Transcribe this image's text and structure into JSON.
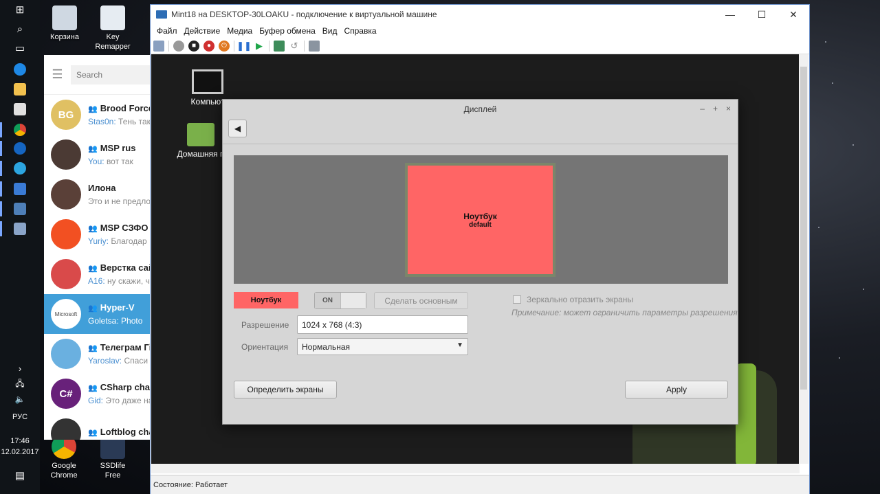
{
  "desktop": {
    "icons": [
      {
        "label": "Корзина"
      },
      {
        "label": "Key Remapper"
      },
      {
        "label": "Google Chrome"
      },
      {
        "label": "SSDlife Free"
      }
    ]
  },
  "taskbar": {
    "language": "РУС",
    "time": "17:46",
    "date": "12.02.2017"
  },
  "telegram": {
    "search_placeholder": "Search",
    "chats": [
      {
        "title": "Brood Force",
        "sender": "Stas0n:",
        "message": "Тень так",
        "initials": "BG",
        "color": "#e0c063",
        "group": true,
        "active": false
      },
      {
        "title": "MSP rus",
        "sender": "You:",
        "message": "вот так",
        "initials": "",
        "color": "#4b3a34",
        "group": true,
        "active": false
      },
      {
        "title": "Илона",
        "sender": "",
        "message": "Это и не предло",
        "initials": "",
        "color": "#5a4038",
        "group": false,
        "active": false
      },
      {
        "title": "MSP СЗФО",
        "sender": "Yuriy:",
        "message": "Благодар",
        "initials": "",
        "color": "#f25022",
        "group": true,
        "active": false
      },
      {
        "title": "Верстка сай",
        "sender": "A16:",
        "message": "ну скажи, ч",
        "initials": "",
        "color": "#d94a4a",
        "group": true,
        "active": false
      },
      {
        "title": "Hyper-V",
        "sender": "Goletsa:",
        "message": "Photo",
        "initials": "Microsoft",
        "color": "#ffffff",
        "group": true,
        "active": true
      },
      {
        "title": "Телеграм Гі",
        "sender": "Yaroslav:",
        "message": "Спаси",
        "initials": "",
        "color": "#6ab0e0",
        "group": true,
        "active": false
      },
      {
        "title": "CSharp chat",
        "sender": "Gid:",
        "message": "Это даже на",
        "initials": "C#",
        "color": "#68217a",
        "group": true,
        "active": false
      },
      {
        "title": "Loftblog cha",
        "sender": "",
        "message": "",
        "initials": "",
        "color": "#333333",
        "group": true,
        "active": false
      }
    ]
  },
  "vm_window": {
    "title": "Mint18 на DESKTOP-30LOAKU - подключение к виртуальной машине",
    "menu": [
      "Файл",
      "Действие",
      "Медиа",
      "Буфер обмена",
      "Вид",
      "Справка"
    ],
    "status": "Состояние: Работает",
    "controls": {
      "minimize": "—",
      "maximize": "☐",
      "close": "✕"
    }
  },
  "guest_desktop": {
    "icons": [
      {
        "label": "Компьют"
      },
      {
        "label": "Домашняя п"
      }
    ]
  },
  "display_dialog": {
    "title": "Дисплей",
    "controls": {
      "minimize": "–",
      "maximize": "+",
      "close": "×"
    },
    "monitor_name": "Ноутбук",
    "monitor_sub": "default",
    "output_badge": "Ноутбук",
    "toggle_on": "ON",
    "set_primary": "Сделать основным",
    "mirror_label": "Зеркально отразить экраны",
    "mirror_note": "Примечание: может ограничить параметры разрешения",
    "resolution_label": "Разрешение",
    "resolution_value": "1024 x 768 (4:3)",
    "orientation_label": "Ориентация",
    "orientation_value": "Нормальная",
    "detect_button": "Определить экраны",
    "apply_button": "Apply"
  }
}
